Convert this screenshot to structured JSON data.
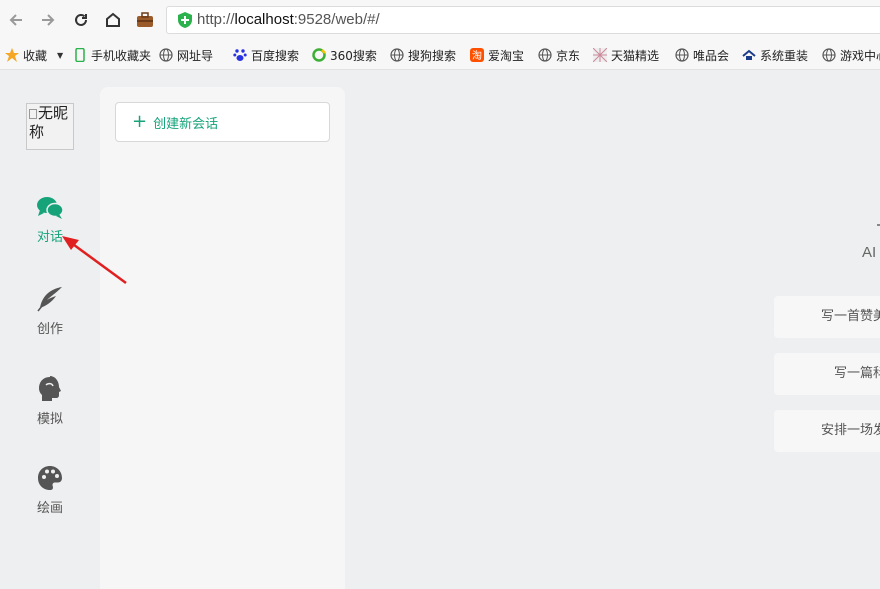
{
  "browser": {
    "url_scheme": "http://",
    "url_host": "localhost",
    "url_rest": ":9528/web/#/"
  },
  "bookmarks": [
    {
      "label": "收藏",
      "icon": "star-icon"
    },
    {
      "label": "手机收藏夹",
      "icon": "phone-icon"
    },
    {
      "label": "网址导",
      "icon": "globe-icon"
    },
    {
      "label": "百度搜索",
      "icon": "baidu-paw-icon"
    },
    {
      "label": "360搜索",
      "icon": "360-icon"
    },
    {
      "label": "搜狗搜索",
      "icon": "globe-icon"
    },
    {
      "label": "爱淘宝",
      "icon": "taobao-icon"
    },
    {
      "label": "京东",
      "icon": "globe-icon"
    },
    {
      "label": "天猫精选",
      "icon": "tmall-icon"
    },
    {
      "label": "唯品会",
      "icon": "globe-icon"
    },
    {
      "label": "系统重装",
      "icon": "system-icon"
    },
    {
      "label": "游戏中心",
      "icon": "globe-icon"
    }
  ],
  "sidebar": {
    "avatar_alt": "无昵称",
    "items": [
      {
        "label": "对话",
        "icon": "chat-bubbles-icon",
        "active": true
      },
      {
        "label": "创作",
        "icon": "feather-icon",
        "active": false
      },
      {
        "label": "模拟",
        "icon": "head-icon",
        "active": false
      },
      {
        "label": "绘画",
        "icon": "palette-icon",
        "active": false
      }
    ]
  },
  "conversations": {
    "new_button_label": "创建新会话"
  },
  "main": {
    "subtitle": "AI",
    "prompts": [
      "写一首赞美",
      "写一篇科",
      "安排一场发"
    ]
  },
  "colors": {
    "accent": "#16a37a",
    "arrow": "#e02020"
  }
}
